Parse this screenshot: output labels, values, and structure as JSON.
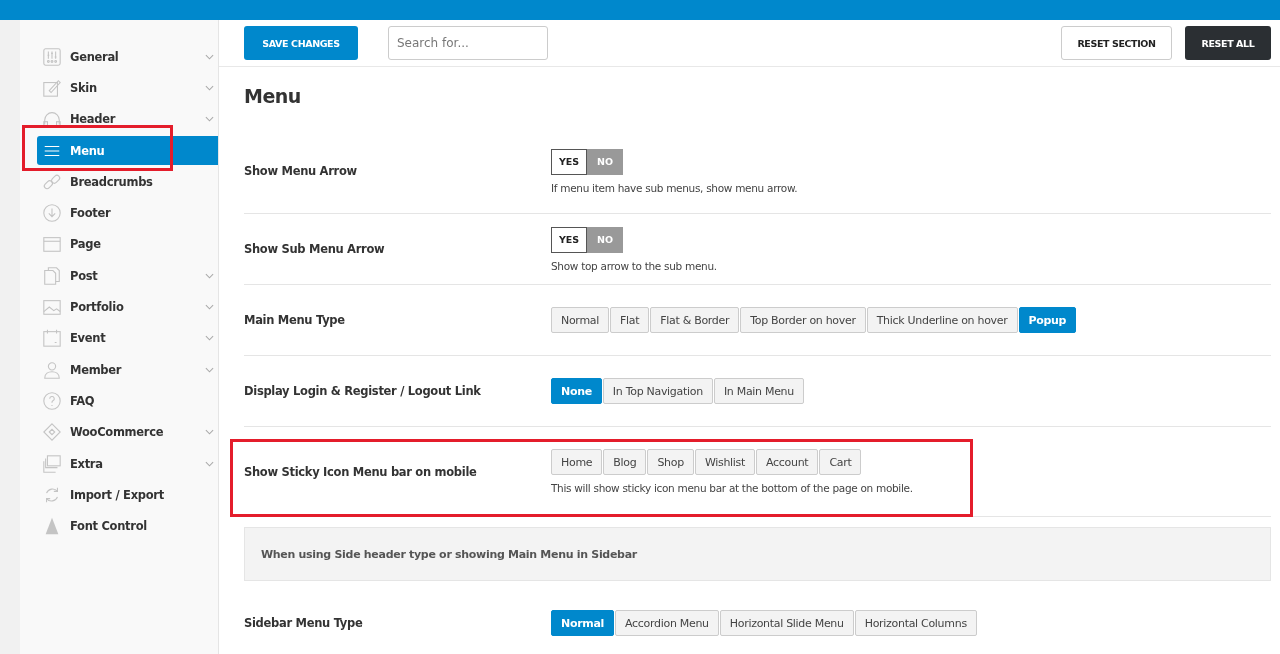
{
  "toolbar": {
    "save": "SAVE CHANGES",
    "search": {
      "placeholder": "Search for..."
    },
    "reset_section": "RESET SECTION",
    "reset_all": "RESET ALL"
  },
  "sidebar": {
    "items": [
      {
        "label": "General",
        "expandable": true,
        "selected": false,
        "highlighted": false
      },
      {
        "label": "Skin",
        "expandable": true,
        "selected": false,
        "highlighted": false
      },
      {
        "label": "Header",
        "expandable": true,
        "selected": false,
        "highlighted": false
      },
      {
        "label": "Menu",
        "expandable": false,
        "selected": true,
        "highlighted": true
      },
      {
        "label": "Breadcrumbs",
        "expandable": false,
        "selected": false,
        "highlighted": false
      },
      {
        "label": "Footer",
        "expandable": false,
        "selected": false,
        "highlighted": false
      },
      {
        "label": "Page",
        "expandable": false,
        "selected": false,
        "highlighted": false
      },
      {
        "label": "Post",
        "expandable": true,
        "selected": false,
        "highlighted": false
      },
      {
        "label": "Portfolio",
        "expandable": true,
        "selected": false,
        "highlighted": false
      },
      {
        "label": "Event",
        "expandable": true,
        "selected": false,
        "highlighted": false
      },
      {
        "label": "Member",
        "expandable": true,
        "selected": false,
        "highlighted": false
      },
      {
        "label": "FAQ",
        "expandable": false,
        "selected": false,
        "highlighted": false
      },
      {
        "label": "WooCommerce",
        "expandable": true,
        "selected": false,
        "highlighted": false
      },
      {
        "label": "Extra",
        "expandable": true,
        "selected": false,
        "highlighted": false
      },
      {
        "label": "Import / Export",
        "expandable": false,
        "selected": false,
        "highlighted": false
      },
      {
        "label": "Font Control",
        "expandable": false,
        "selected": false,
        "highlighted": false
      }
    ]
  },
  "section": {
    "title": "Menu",
    "rows": [
      {
        "kind": "switch",
        "label": "Show Menu Arrow",
        "highlighted": false,
        "options": [
          {
            "label": "YES",
            "selected": true
          },
          {
            "label": "NO",
            "selected": false
          }
        ],
        "description": "If menu item have sub menus, show menu arrow."
      },
      {
        "kind": "switch",
        "label": "Show Sub Menu Arrow",
        "highlighted": false,
        "options": [
          {
            "label": "YES",
            "selected": true
          },
          {
            "label": "NO",
            "selected": false
          }
        ],
        "description": "Show top arrow to the sub menu."
      },
      {
        "kind": "buttons",
        "label": "Main Menu Type",
        "highlighted": false,
        "options": [
          {
            "label": "Normal",
            "selected": false
          },
          {
            "label": "Flat",
            "selected": false
          },
          {
            "label": "Flat & Border",
            "selected": false
          },
          {
            "label": "Top Border on hover",
            "selected": false
          },
          {
            "label": "Thick Underline on hover",
            "selected": false
          },
          {
            "label": "Popup",
            "selected": true
          }
        ]
      },
      {
        "kind": "buttons",
        "label": "Display Login & Register / Logout Link",
        "highlighted": false,
        "options": [
          {
            "label": "None",
            "selected": true
          },
          {
            "label": "In Top Navigation",
            "selected": false
          },
          {
            "label": "In Main Menu",
            "selected": false
          }
        ]
      },
      {
        "kind": "buttons",
        "label": "Show Sticky Icon Menu bar on mobile",
        "highlighted": true,
        "options": [
          {
            "label": "Home",
            "selected": false
          },
          {
            "label": "Blog",
            "selected": false
          },
          {
            "label": "Shop",
            "selected": false
          },
          {
            "label": "Wishlist",
            "selected": false
          },
          {
            "label": "Account",
            "selected": false
          },
          {
            "label": "Cart",
            "selected": false
          }
        ],
        "description": "This will show sticky icon menu bar at the bottom of the page on mobile."
      },
      {
        "kind": "notice",
        "text": "When using Side header type or showing Main Menu in Sidebar"
      },
      {
        "kind": "buttons",
        "label": "Sidebar Menu Type",
        "highlighted": false,
        "options": [
          {
            "label": "Normal",
            "selected": true
          },
          {
            "label": "Accordion Menu",
            "selected": false
          },
          {
            "label": "Horizontal Slide Menu",
            "selected": false
          },
          {
            "label": "Horizontal Columns",
            "selected": false
          }
        ]
      }
    ]
  }
}
